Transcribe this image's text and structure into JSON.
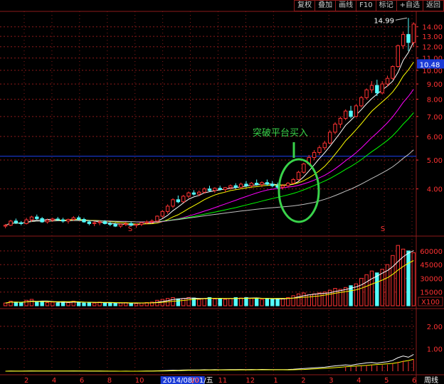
{
  "toolbar": {
    "buttons": [
      "复权",
      "叠加",
      "画线",
      "F10",
      "标记",
      "+自选",
      "返回"
    ]
  },
  "annotation": {
    "text": "突破平台买入"
  },
  "chart_data": [
    {
      "type": "candlestick",
      "panel": "price",
      "y_ticks": [
        "14.00",
        "13.00",
        "12.00",
        "11.00",
        "10.00",
        "9.00",
        "8.00",
        "7.00",
        "6.00",
        "5.00",
        "4.00"
      ],
      "y_tick_values": [
        14,
        13,
        12,
        11,
        10,
        9,
        8,
        7,
        6,
        5,
        4
      ],
      "scale": "log",
      "ylim": [
        3.0,
        15.6
      ],
      "max_label": "14.99",
      "max_value": 14.99,
      "last_price_label": "10.48",
      "last_price": 10.48,
      "horizontal_line": 5.15,
      "candles": [
        [
          3.0,
          3.05,
          2.95,
          3.02
        ],
        [
          3.02,
          3.15,
          3.0,
          3.12
        ],
        [
          3.12,
          3.18,
          3.05,
          3.08
        ],
        [
          3.08,
          3.12,
          3.02,
          3.06
        ],
        [
          3.06,
          3.2,
          3.04,
          3.15
        ],
        [
          3.15,
          3.25,
          3.1,
          3.22
        ],
        [
          3.22,
          3.28,
          3.15,
          3.18
        ],
        [
          3.18,
          3.22,
          3.08,
          3.1
        ],
        [
          3.1,
          3.18,
          3.06,
          3.14
        ],
        [
          3.14,
          3.2,
          3.1,
          3.17
        ],
        [
          3.17,
          3.22,
          3.12,
          3.15
        ],
        [
          3.15,
          3.2,
          3.08,
          3.12
        ],
        [
          3.12,
          3.18,
          3.06,
          3.16
        ],
        [
          3.16,
          3.24,
          3.12,
          3.2
        ],
        [
          3.2,
          3.25,
          3.14,
          3.16
        ],
        [
          3.16,
          3.2,
          3.08,
          3.1
        ],
        [
          3.1,
          3.14,
          3.02,
          3.06
        ],
        [
          3.06,
          3.12,
          3.0,
          3.08
        ],
        [
          3.08,
          3.14,
          3.02,
          3.1
        ],
        [
          3.1,
          3.14,
          3.04,
          3.06
        ],
        [
          3.06,
          3.1,
          3.0,
          3.04
        ],
        [
          3.04,
          3.08,
          2.98,
          3.0
        ],
        [
          3.0,
          3.06,
          2.96,
          3.04
        ],
        [
          3.04,
          3.1,
          3.0,
          3.06
        ],
        [
          3.06,
          3.1,
          3.0,
          3.02
        ],
        [
          3.02,
          3.06,
          2.96,
          3.04
        ],
        [
          3.04,
          3.1,
          3.0,
          3.08
        ],
        [
          3.08,
          3.14,
          3.04,
          3.1
        ],
        [
          3.1,
          3.16,
          3.06,
          3.12
        ],
        [
          3.12,
          3.26,
          3.1,
          3.24
        ],
        [
          3.24,
          3.4,
          3.2,
          3.36
        ],
        [
          3.36,
          3.55,
          3.3,
          3.5
        ],
        [
          3.5,
          3.72,
          3.45,
          3.68
        ],
        [
          3.68,
          3.8,
          3.58,
          3.62
        ],
        [
          3.62,
          3.82,
          3.6,
          3.78
        ],
        [
          3.78,
          3.92,
          3.72,
          3.88
        ],
        [
          3.88,
          3.96,
          3.8,
          3.84
        ],
        [
          3.84,
          3.95,
          3.78,
          3.9
        ],
        [
          3.9,
          4.05,
          3.86,
          4.0
        ],
        [
          4.0,
          4.1,
          3.92,
          3.95
        ],
        [
          3.95,
          4.05,
          3.88,
          4.02
        ],
        [
          4.02,
          4.1,
          3.95,
          3.98
        ],
        [
          3.98,
          4.06,
          3.9,
          4.04
        ],
        [
          4.04,
          4.14,
          3.98,
          4.1
        ],
        [
          4.1,
          4.18,
          4.0,
          4.05
        ],
        [
          4.05,
          4.2,
          4.0,
          4.15
        ],
        [
          4.15,
          4.25,
          4.05,
          4.1
        ],
        [
          4.1,
          4.22,
          4.02,
          4.18
        ],
        [
          4.18,
          4.3,
          4.1,
          4.14
        ],
        [
          4.14,
          4.24,
          4.05,
          4.2
        ],
        [
          4.2,
          4.3,
          4.1,
          4.15
        ],
        [
          4.15,
          4.25,
          4.05,
          4.1
        ],
        [
          4.1,
          4.2,
          4.0,
          4.05
        ],
        [
          4.05,
          4.15,
          3.98,
          4.1
        ],
        [
          4.1,
          4.22,
          4.04,
          4.18
        ],
        [
          4.18,
          4.35,
          4.15,
          4.3
        ],
        [
          4.3,
          4.6,
          4.26,
          4.55
        ],
        [
          4.55,
          4.9,
          4.5,
          4.85
        ],
        [
          4.85,
          5.2,
          4.8,
          5.1
        ],
        [
          5.1,
          5.4,
          5.0,
          5.3
        ],
        [
          5.3,
          5.6,
          5.2,
          5.5
        ],
        [
          5.5,
          5.8,
          5.4,
          5.7
        ],
        [
          5.7,
          6.3,
          5.65,
          6.2
        ],
        [
          6.2,
          6.7,
          6.1,
          6.6
        ],
        [
          6.6,
          7.0,
          6.4,
          6.9
        ],
        [
          6.9,
          7.4,
          6.8,
          7.3
        ],
        [
          7.3,
          7.6,
          6.9,
          7.0
        ],
        [
          7.0,
          7.7,
          6.95,
          7.6
        ],
        [
          7.6,
          8.2,
          7.5,
          8.1
        ],
        [
          8.1,
          8.7,
          8.0,
          8.6
        ],
        [
          8.6,
          9.2,
          8.4,
          8.9
        ],
        [
          8.9,
          9.3,
          8.2,
          8.4
        ],
        [
          8.4,
          9.2,
          8.3,
          9.0
        ],
        [
          9.0,
          9.6,
          8.8,
          9.4
        ],
        [
          9.4,
          10.4,
          9.3,
          10.3
        ],
        [
          10.3,
          12.2,
          10.2,
          12.1
        ],
        [
          12.1,
          13.5,
          11.8,
          13.2
        ],
        [
          13.2,
          14.99,
          11.6,
          12.4
        ],
        [
          12.4,
          14.5,
          12.0,
          14.3
        ]
      ]
    },
    {
      "type": "bar",
      "panel": "volume",
      "y_ticks": [
        "60000",
        "45000",
        "30000",
        "15000"
      ],
      "y_tick_values": [
        60000,
        45000,
        30000,
        15000
      ],
      "ylim": [
        0,
        70000
      ],
      "unit_label": "X100",
      "values": [
        3000,
        5000,
        4000,
        3500,
        6000,
        7000,
        4000,
        5000,
        3500,
        4000,
        3000,
        4500,
        3500,
        5000,
        4000,
        3000,
        3500,
        3000,
        4000,
        3500,
        3000,
        2500,
        3000,
        3500,
        3000,
        2500,
        3000,
        3500,
        4000,
        6000,
        7000,
        8000,
        9000,
        7500,
        8000,
        9000,
        8500,
        7000,
        8000,
        9000,
        7500,
        8000,
        7000,
        8000,
        9000,
        8500,
        9000,
        8000,
        8500,
        7000,
        8000,
        7000,
        7500,
        8000,
        9000,
        11000,
        13000,
        14000,
        12000,
        13000,
        14000,
        15000,
        17000,
        19000,
        18000,
        20000,
        22000,
        24000,
        30000,
        34000,
        38000,
        36000,
        40000,
        45000,
        55000,
        66000,
        62000,
        60000,
        58000
      ]
    },
    {
      "type": "line",
      "panel": "indicator",
      "y_ticks": [
        "2.00",
        "1.00"
      ],
      "y_tick_values": [
        2.0,
        1.0
      ],
      "ylim": [
        0,
        2.6
      ]
    }
  ],
  "x_ticks": [
    "2",
    "4",
    "6",
    "8",
    "10",
    "2014/08/01/五",
    "10",
    "11",
    "12",
    "1",
    "2",
    "3",
    "4",
    "5",
    "6"
  ],
  "corner_label": "周线",
  "colors": {
    "up": "#ff3232",
    "down": "#54fcfc",
    "grid": "#8c1a1a",
    "axis_text": "#ff3232",
    "ma5": "#ffffff",
    "ma10": "#ffff00",
    "ma20": "#ff00ff",
    "ma30": "#00ff00",
    "ma60": "#c0c0c0",
    "hline": "#1a3ad6",
    "annotation": "#39d34a",
    "indicator_fast": "#ffffff",
    "indicator_slow": "#ffff00",
    "indicator_bar": "#ff3232"
  }
}
